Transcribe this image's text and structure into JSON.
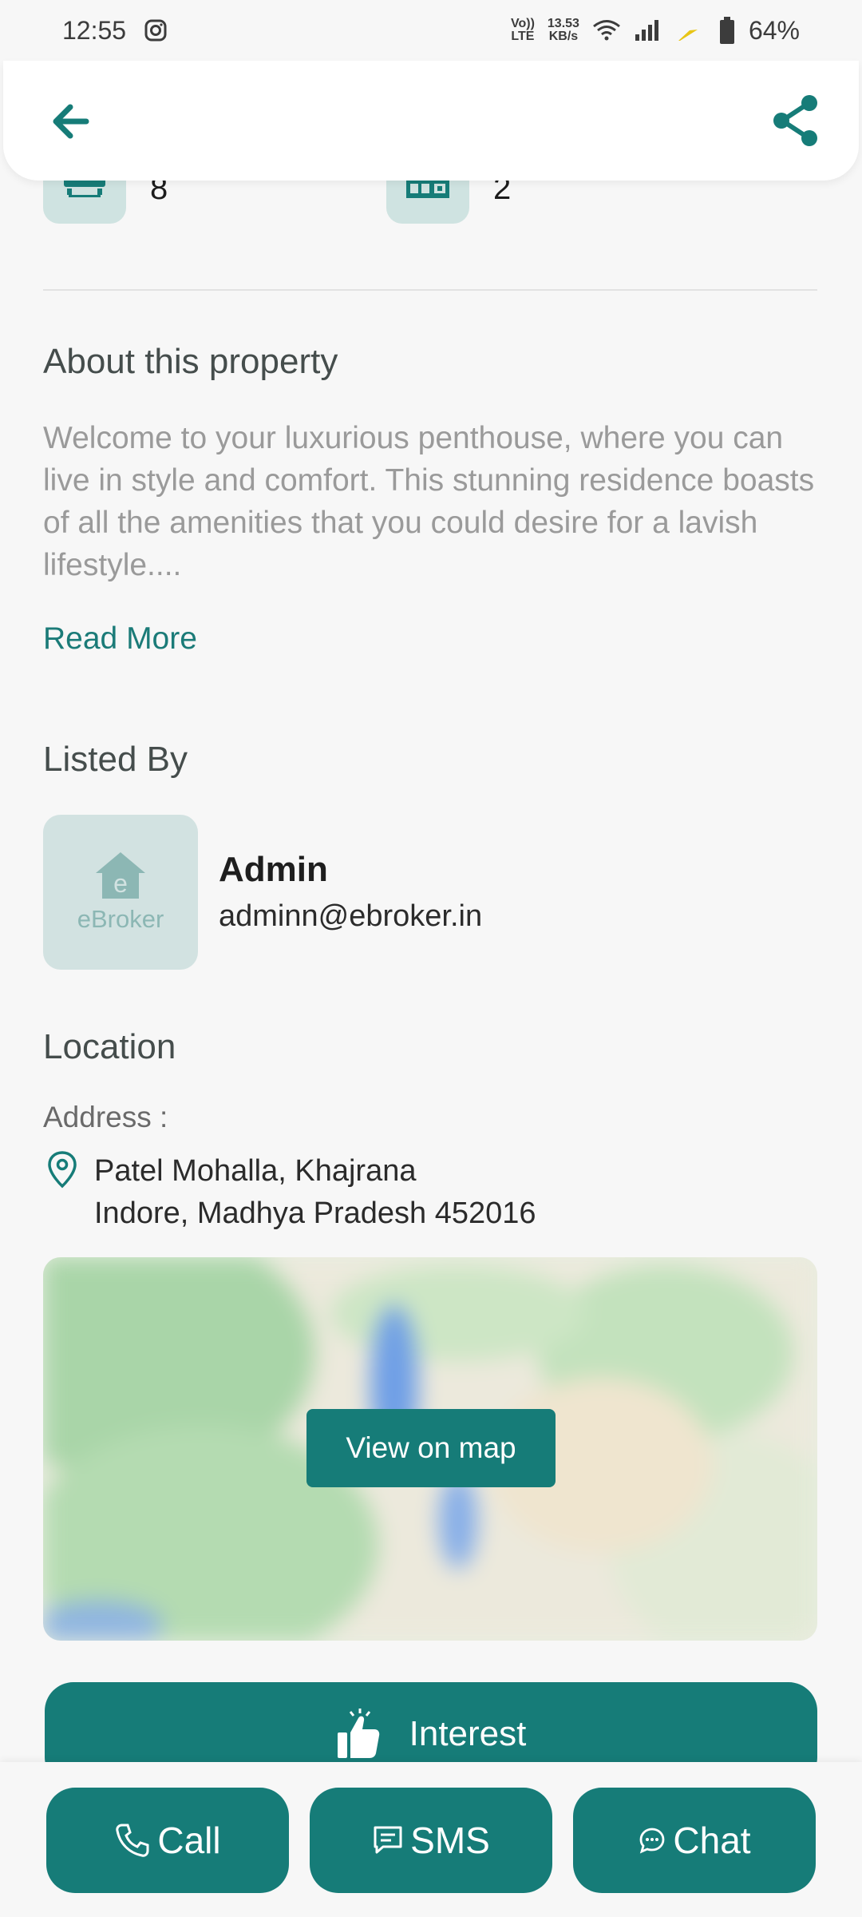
{
  "status_bar": {
    "time": "12:55",
    "lte_top": "Vo))",
    "lte_bottom": "LTE",
    "speed_top": "13.53",
    "speed_bottom": "KB/s",
    "battery": "64%"
  },
  "stats": [
    {
      "icon": "bathtub-icon",
      "value": "8"
    },
    {
      "icon": "kitchen-icon",
      "value": "2"
    }
  ],
  "about": {
    "title": "About this property",
    "description": "Welcome to your luxurious penthouse, where you can live in style and comfort. This stunning residence boasts of all the amenities that you could desire for a lavish lifestyle....",
    "read_more": "Read More"
  },
  "listed_by": {
    "title": "Listed By",
    "logo_text": "eBroker",
    "name": "Admin",
    "email": "adminn@ebroker.in"
  },
  "location": {
    "title": "Location",
    "address_label": "Address :",
    "line1": "Patel Mohalla, Khajrana",
    "line2": "Indore, Madhya Pradesh 452016",
    "view_on_map": "View on map"
  },
  "actions": {
    "interest": "Interest",
    "call": "Call",
    "sms": "SMS",
    "chat": "Chat"
  },
  "colors": {
    "primary": "#167c78",
    "icon_bg": "#cfe3e1",
    "background": "#f7f7f7"
  }
}
